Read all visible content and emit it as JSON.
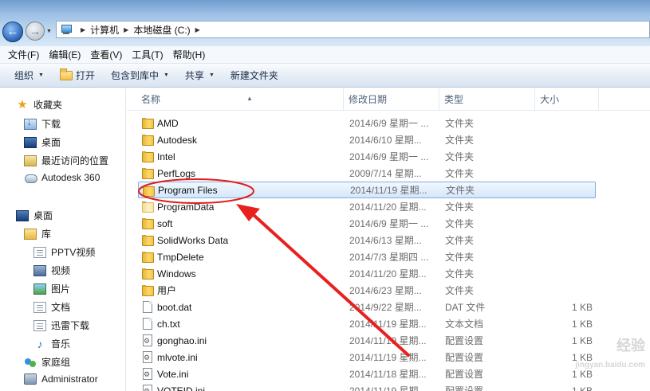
{
  "breadcrumb": {
    "items": [
      "计算机",
      "本地磁盘 (C:)"
    ]
  },
  "menu": [
    "文件(F)",
    "编辑(E)",
    "查看(V)",
    "工具(T)",
    "帮助(H)"
  ],
  "toolbar": {
    "organize": "组织",
    "open": "打开",
    "include_library": "包含到库中",
    "share": "共享",
    "new_folder": "新建文件夹"
  },
  "nav": {
    "favorites": "收藏夹",
    "downloads": "下载",
    "desktop_fav": "桌面",
    "recent": "最近访问的位置",
    "autodesk": "Autodesk 360",
    "desktop": "桌面",
    "libraries": "库",
    "pptv": "PPTV视频",
    "video": "视频",
    "pictures": "图片",
    "documents": "文档",
    "thunder": "迅雷下载",
    "music": "音乐",
    "homegroup": "家庭组",
    "admin": "Administrator"
  },
  "columns": {
    "name": "名称",
    "date": "修改日期",
    "type": "类型",
    "size": "大小"
  },
  "files": [
    {
      "name": "AMD",
      "date": "2014/6/9 星期一 ...",
      "type": "文件夹",
      "size": "",
      "kind": "folder"
    },
    {
      "name": "Autodesk",
      "date": "2014/6/10 星期...",
      "type": "文件夹",
      "size": "",
      "kind": "folder"
    },
    {
      "name": "Intel",
      "date": "2014/6/9 星期一 ...",
      "type": "文件夹",
      "size": "",
      "kind": "folder"
    },
    {
      "name": "PerfLogs",
      "date": "2009/7/14 星期...",
      "type": "文件夹",
      "size": "",
      "kind": "folder"
    },
    {
      "name": "Program Files",
      "date": "2014/11/19 星期...",
      "type": "文件夹",
      "size": "",
      "kind": "folder"
    },
    {
      "name": "ProgramData",
      "date": "2014/11/20 星期...",
      "type": "文件夹",
      "size": "",
      "kind": "folder-light"
    },
    {
      "name": "soft",
      "date": "2014/6/9 星期一 ...",
      "type": "文件夹",
      "size": "",
      "kind": "folder"
    },
    {
      "name": "SolidWorks Data",
      "date": "2014/6/13 星期...",
      "type": "文件夹",
      "size": "",
      "kind": "folder"
    },
    {
      "name": "TmpDelete",
      "date": "2014/7/3 星期四 ...",
      "type": "文件夹",
      "size": "",
      "kind": "folder"
    },
    {
      "name": "Windows",
      "date": "2014/11/20 星期...",
      "type": "文件夹",
      "size": "",
      "kind": "folder"
    },
    {
      "name": "用户",
      "date": "2014/6/23 星期...",
      "type": "文件夹",
      "size": "",
      "kind": "folder"
    },
    {
      "name": "boot.dat",
      "date": "2014/9/22 星期...",
      "type": "DAT 文件",
      "size": "1 KB",
      "kind": "file"
    },
    {
      "name": "ch.txt",
      "date": "2014/11/19 星期...",
      "type": "文本文档",
      "size": "1 KB",
      "kind": "file"
    },
    {
      "name": "gonghao.ini",
      "date": "2014/11/19 星期...",
      "type": "配置设置",
      "size": "1 KB",
      "kind": "cfg"
    },
    {
      "name": "mlvote.ini",
      "date": "2014/11/19 星期...",
      "type": "配置设置",
      "size": "1 KB",
      "kind": "cfg"
    },
    {
      "name": "Vote.ini",
      "date": "2014/11/18 星期...",
      "type": "配置设置",
      "size": "1 KB",
      "kind": "cfg"
    },
    {
      "name": "VOTEID.ini",
      "date": "2014/11/19 星期...",
      "type": "配置设置",
      "size": "1 KB",
      "kind": "cfg"
    }
  ],
  "selected_index": 4,
  "watermark": [
    "经验",
    "jingyan.baidu.com"
  ]
}
